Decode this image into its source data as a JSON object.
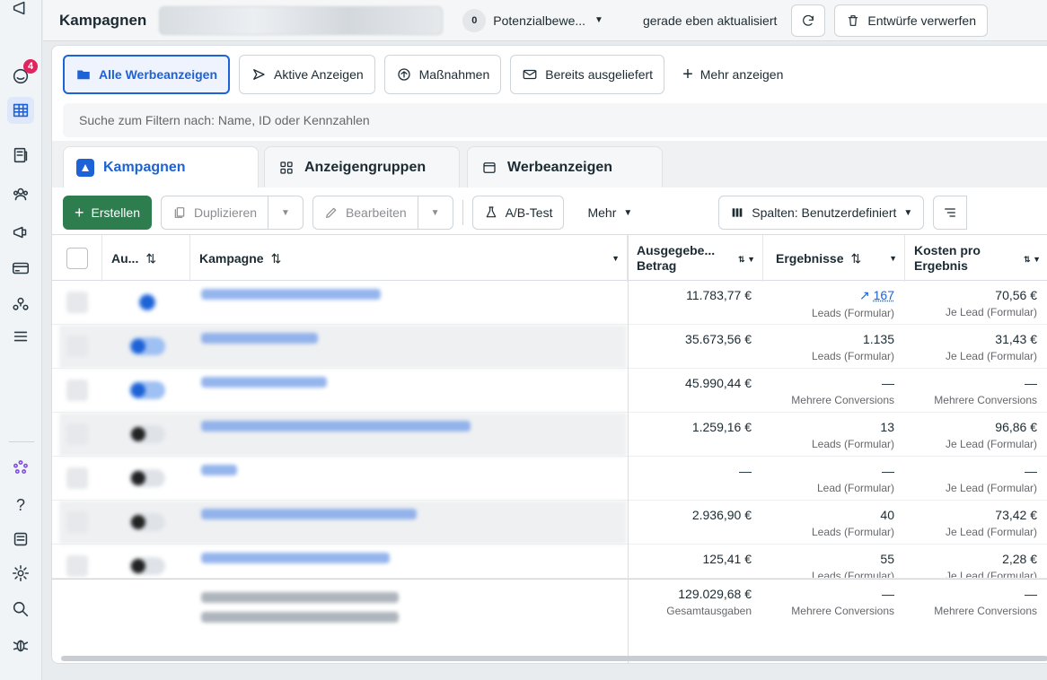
{
  "rail": {
    "notifications_badge": "4"
  },
  "topbar": {
    "title": "Kampagnen",
    "status_count": "0",
    "status_label": "Potenzialbewe...",
    "updated_text": "gerade eben aktualisiert",
    "discard_label": "Entwürfe verwerfen"
  },
  "filters": {
    "all_ads": "Alle Werbeanzeigen",
    "active_ads": "Aktive Anzeigen",
    "actions": "Maßnahmen",
    "delivered": "Bereits ausgeliefert",
    "more": "Mehr anzeigen"
  },
  "search": {
    "placeholder": "Suche zum Filtern nach: Name, ID oder Kennzahlen"
  },
  "tabs": {
    "campaigns": "Kampagnen",
    "adsets": "Anzeigengruppen",
    "ads": "Werbeanzeigen"
  },
  "toolbar": {
    "create": "Erstellen",
    "duplicate": "Duplizieren",
    "edit": "Bearbeiten",
    "ab_test": "A/B-Test",
    "more": "Mehr",
    "columns": "Spalten: Benutzerdefiniert"
  },
  "table": {
    "headers": {
      "delivery": "Au...",
      "campaign": "Kampagne",
      "spent": "Ausgegebe... Betrag",
      "spent_line1": "Ausgegebe...",
      "spent_line2": "Betrag",
      "results": "Ergebnisse",
      "cost_line1": "Kosten pro",
      "cost_line2": "Ergebnis"
    },
    "rows": [
      {
        "spent": "11.783,77 €",
        "results": "167",
        "results_sub": "Leads (Formular)",
        "cost": "70,56 €",
        "cost_sub": "Je Lead (Formular)"
      },
      {
        "spent": "35.673,56 €",
        "results": "1.135",
        "results_sub": "Leads (Formular)",
        "cost": "31,43 €",
        "cost_sub": "Je Lead (Formular)"
      },
      {
        "spent": "45.990,44 €",
        "results": "—",
        "results_sub": "Mehrere Conversions",
        "cost": "—",
        "cost_sub": "Mehrere Conversions"
      },
      {
        "spent": "1.259,16 €",
        "results": "13",
        "results_sub": "Leads (Formular)",
        "cost": "96,86 €",
        "cost_sub": "Je Lead (Formular)"
      },
      {
        "spent": "—",
        "results": "—",
        "results_sub": "Lead (Formular)",
        "cost": "—",
        "cost_sub": "Je Lead (Formular)"
      },
      {
        "spent": "2.936,90 €",
        "results": "40",
        "results_sub": "Leads (Formular)",
        "cost": "73,42 €",
        "cost_sub": "Je Lead (Formular)"
      },
      {
        "spent": "125,41 €",
        "results": "55",
        "results_sub": "Leads (Formular)",
        "cost": "2,28 €",
        "cost_sub": "Je Lead (Formular)"
      }
    ],
    "totals": {
      "spent": "129.029,68 €",
      "spent_sub": "Gesamtausgaben",
      "results": "—",
      "results_sub": "Mehrere Conversions",
      "cost": "—",
      "cost_sub": "Mehrere Conversions"
    }
  }
}
